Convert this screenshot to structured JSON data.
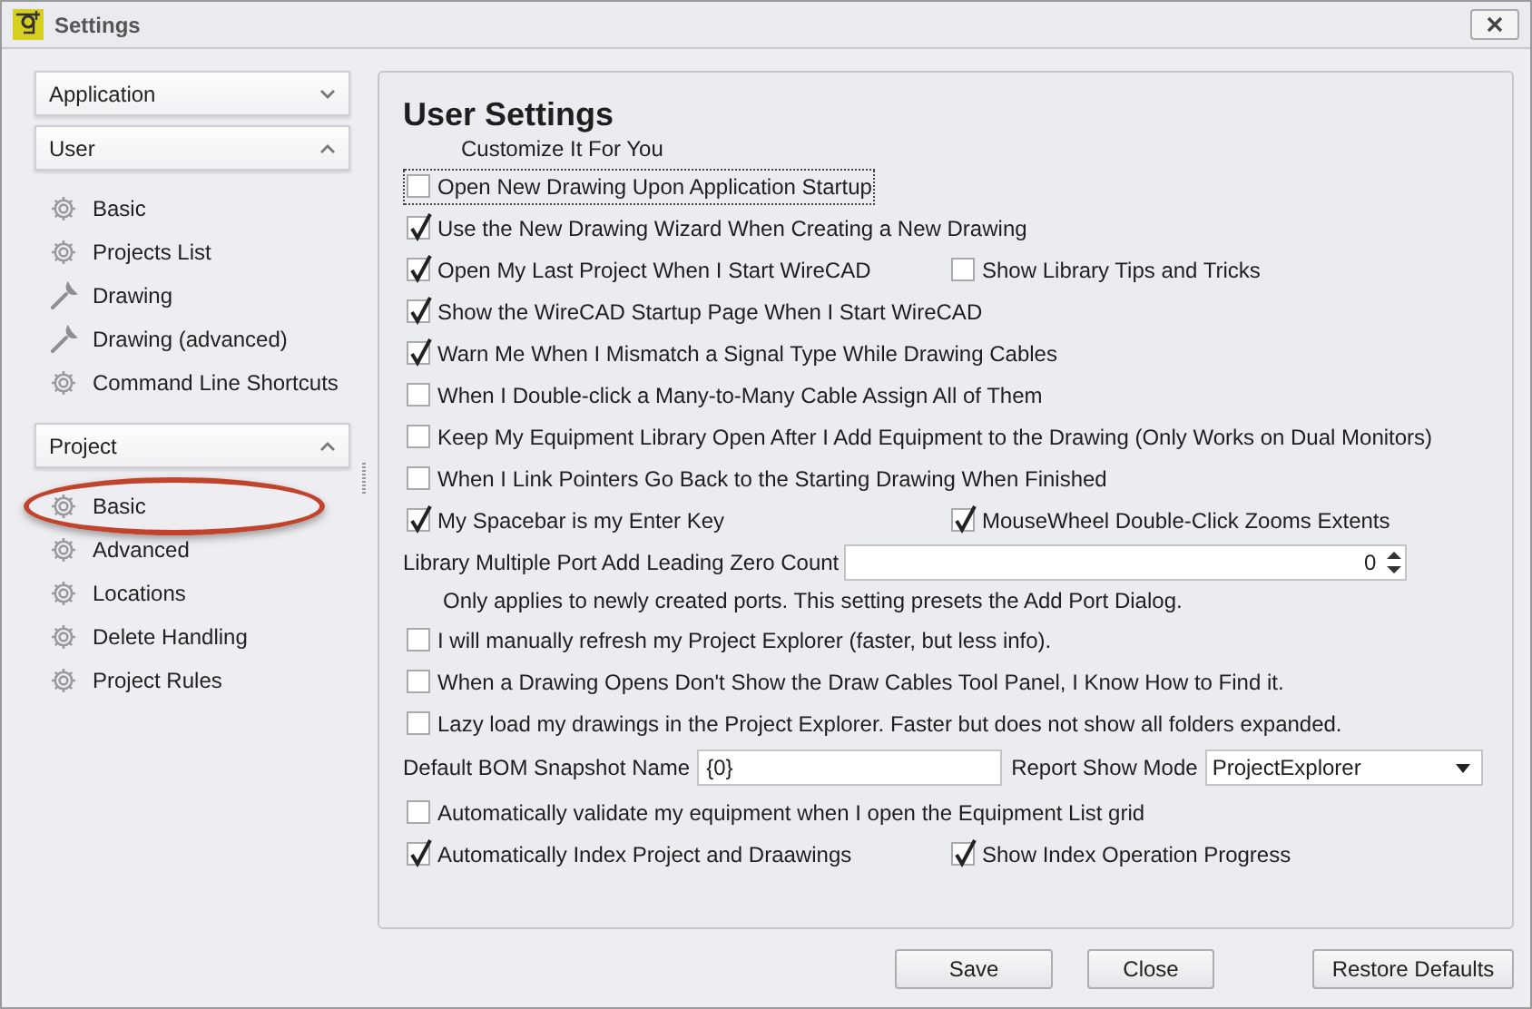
{
  "window": {
    "title": "Settings"
  },
  "sidebar": {
    "groups": [
      {
        "label": "Application",
        "expanded": false
      },
      {
        "label": "User",
        "expanded": true,
        "items": [
          {
            "label": "Basic",
            "kind": "gear",
            "highlighted": false
          },
          {
            "label": "Projects List",
            "kind": "gear",
            "highlighted": false
          },
          {
            "label": "Drawing",
            "kind": "wrench",
            "highlighted": false
          },
          {
            "label": "Drawing (advanced)",
            "kind": "wrench",
            "highlighted": false
          },
          {
            "label": "Command Line Shortcuts",
            "kind": "gear",
            "highlighted": false
          }
        ]
      },
      {
        "label": "Project",
        "expanded": true,
        "items": [
          {
            "label": "Basic",
            "kind": "gear",
            "highlighted": true
          },
          {
            "label": "Advanced",
            "kind": "gear",
            "highlighted": false
          },
          {
            "label": "Locations",
            "kind": "gear",
            "highlighted": false
          },
          {
            "label": "Delete Handling",
            "kind": "gear",
            "highlighted": false
          },
          {
            "label": "Project Rules",
            "kind": "gear",
            "highlighted": false
          }
        ]
      }
    ]
  },
  "panel": {
    "title": "User Settings",
    "subtitle": "Customize It For You",
    "rows": [
      {
        "kind": "checks",
        "items": [
          {
            "label": "Open New Drawing Upon Application Startup",
            "checked": false,
            "focused": true
          }
        ]
      },
      {
        "kind": "checks",
        "items": [
          {
            "label": "Use the New Drawing Wizard When Creating a New Drawing",
            "checked": true,
            "focused": false
          }
        ]
      },
      {
        "kind": "checks",
        "items": [
          {
            "label": "Open My Last Project When I Start WireCAD",
            "checked": true,
            "focused": false
          },
          {
            "label": "Show Library Tips and Tricks",
            "checked": false,
            "focused": false
          }
        ]
      },
      {
        "kind": "checks",
        "items": [
          {
            "label": "Show the WireCAD Startup Page When I Start WireCAD",
            "checked": true,
            "focused": false
          }
        ]
      },
      {
        "kind": "checks",
        "items": [
          {
            "label": "Warn Me When I Mismatch a Signal Type While Drawing Cables",
            "checked": true,
            "focused": false
          }
        ]
      },
      {
        "kind": "checks",
        "items": [
          {
            "label": "When I Double-click a Many-to-Many Cable Assign All of Them",
            "checked": false,
            "focused": false
          }
        ]
      },
      {
        "kind": "checks",
        "items": [
          {
            "label": "Keep My Equipment Library Open After I Add Equipment to the Drawing (Only Works on Dual Monitors)",
            "checked": false,
            "focused": false
          }
        ]
      },
      {
        "kind": "checks",
        "items": [
          {
            "label": "When I Link Pointers Go Back to the Starting Drawing When Finished",
            "checked": false,
            "focused": false
          }
        ]
      },
      {
        "kind": "checks",
        "items": [
          {
            "label": "My Spacebar is my Enter Key",
            "checked": true,
            "focused": false
          },
          {
            "label": "MouseWheel Double-Click Zooms Extents",
            "checked": true,
            "focused": false
          }
        ]
      },
      {
        "kind": "spin",
        "label": "Library Multiple Port Add Leading Zero Count",
        "value": "0"
      },
      {
        "kind": "note",
        "text": "Only applies to newly created ports. This setting presets the Add Port Dialog."
      },
      {
        "kind": "checks",
        "items": [
          {
            "label": "I will manually refresh my Project Explorer (faster, but less info).",
            "checked": false,
            "focused": false
          }
        ]
      },
      {
        "kind": "checks",
        "items": [
          {
            "label": "When a Drawing Opens Don't Show the Draw Cables Tool Panel, I Know How to Find it.",
            "checked": false,
            "focused": false
          }
        ]
      },
      {
        "kind": "checks",
        "items": [
          {
            "label": "Lazy load my drawings in the Project Explorer. Faster but does not show all folders expanded.",
            "checked": false,
            "focused": false
          }
        ]
      },
      {
        "kind": "fields",
        "label": "Default BOM Snapshot Name",
        "value": "{0}",
        "select_label": "Report Show Mode",
        "select_value": "ProjectExplorer"
      },
      {
        "kind": "checks",
        "items": [
          {
            "label": "Automatically validate my equipment when I open the Equipment List grid",
            "checked": false,
            "focused": false
          }
        ]
      },
      {
        "kind": "checks",
        "items": [
          {
            "label": "Automatically Index Project and Draawings",
            "checked": true,
            "focused": false
          },
          {
            "label": "Show Index Operation Progress",
            "checked": true,
            "focused": false
          }
        ]
      }
    ]
  },
  "buttons": [
    "Save",
    "Close",
    "Restore Defaults"
  ]
}
